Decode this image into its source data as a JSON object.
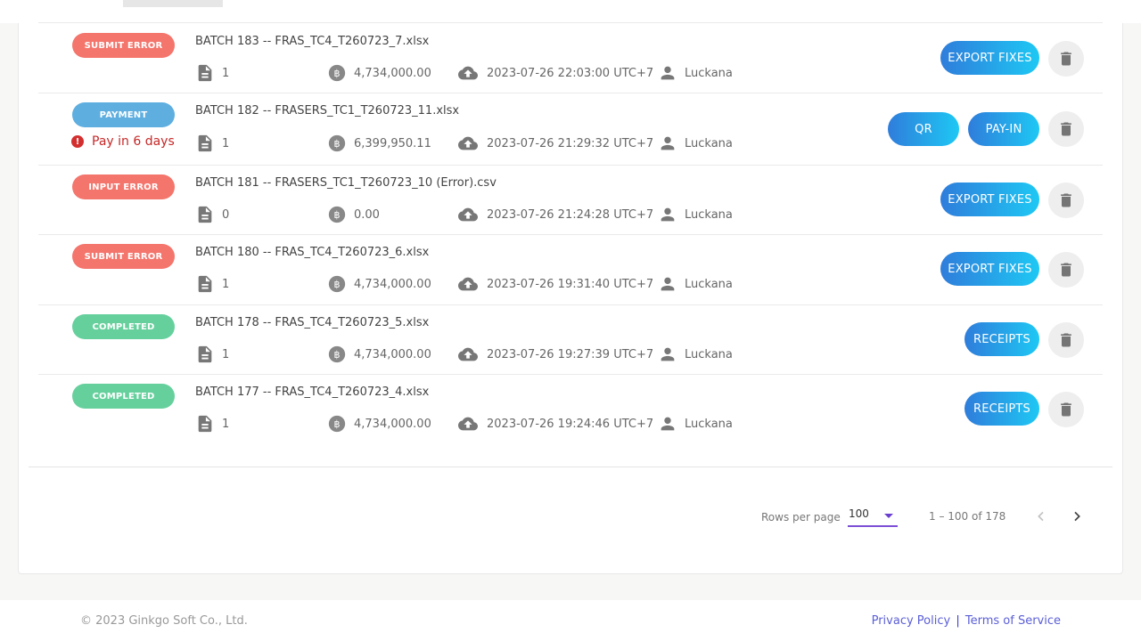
{
  "rows": [
    {
      "status": "SUBMIT ERROR",
      "status_color": "#f4756c",
      "batch": "BATCH  183  -- FRAS_TC4_T260723_7.xlsx",
      "count": "1",
      "amount": "4,734,000.00",
      "uploaded": "2023-07-26 22:03:00 UTC+7",
      "user": "Luckana",
      "actions": [
        "EXPORT FIXES"
      ]
    },
    {
      "status": "PAYMENT",
      "status_color": "#5eaee0",
      "warning": "Pay in 6 days",
      "batch": "BATCH  182  -- FRASERS_TC1_T260723_11.xlsx",
      "count": "1",
      "amount": "6,399,950.11",
      "uploaded": "2023-07-26 21:29:32 UTC+7",
      "user": "Luckana",
      "actions": [
        "QR",
        "PAY-IN"
      ]
    },
    {
      "status": "INPUT ERROR",
      "status_color": "#f4756c",
      "batch": "BATCH  181  -- FRASERS_TC1_T260723_10 (Error).csv",
      "count": "0",
      "amount": "0.00",
      "uploaded": "2023-07-26 21:24:28 UTC+7",
      "user": "Luckana",
      "actions": [
        "EXPORT FIXES"
      ]
    },
    {
      "status": "SUBMIT ERROR",
      "status_color": "#f4756c",
      "batch": "BATCH  180  -- FRAS_TC4_T260723_6.xlsx",
      "count": "1",
      "amount": "4,734,000.00",
      "uploaded": "2023-07-26 19:31:40 UTC+7",
      "user": "Luckana",
      "actions": [
        "EXPORT FIXES"
      ]
    },
    {
      "status": "COMPLETED",
      "status_color": "#66d09d",
      "batch": "BATCH  178  -- FRAS_TC4_T260723_5.xlsx",
      "count": "1",
      "amount": "4,734,000.00",
      "uploaded": "2023-07-26 19:27:39 UTC+7",
      "user": "Luckana",
      "actions": [
        "RECEIPTS"
      ]
    },
    {
      "status": "COMPLETED",
      "status_color": "#66d09d",
      "batch": "BATCH  177  -- FRAS_TC4_T260723_4.xlsx",
      "count": "1",
      "amount": "4,734,000.00",
      "uploaded": "2023-07-26 19:24:46 UTC+7",
      "user": "Luckana",
      "actions": [
        "RECEIPTS"
      ]
    }
  ],
  "pagination": {
    "rows_per_page_label": "Rows per page",
    "rows_per_page_value": "100",
    "range": "1 – 100 of 178"
  },
  "footer": {
    "copyright": "© 2023 Ginkgo Soft Co., Ltd.",
    "privacy": "Privacy Policy",
    "separator": "|",
    "terms": "Terms of Service"
  },
  "icons": {
    "file": "document-icon",
    "amount": "baht-coin-icon",
    "upload": "cloud-upload-icon",
    "user": "person-icon",
    "delete": "trash-icon",
    "warning": "exclamation-icon"
  }
}
